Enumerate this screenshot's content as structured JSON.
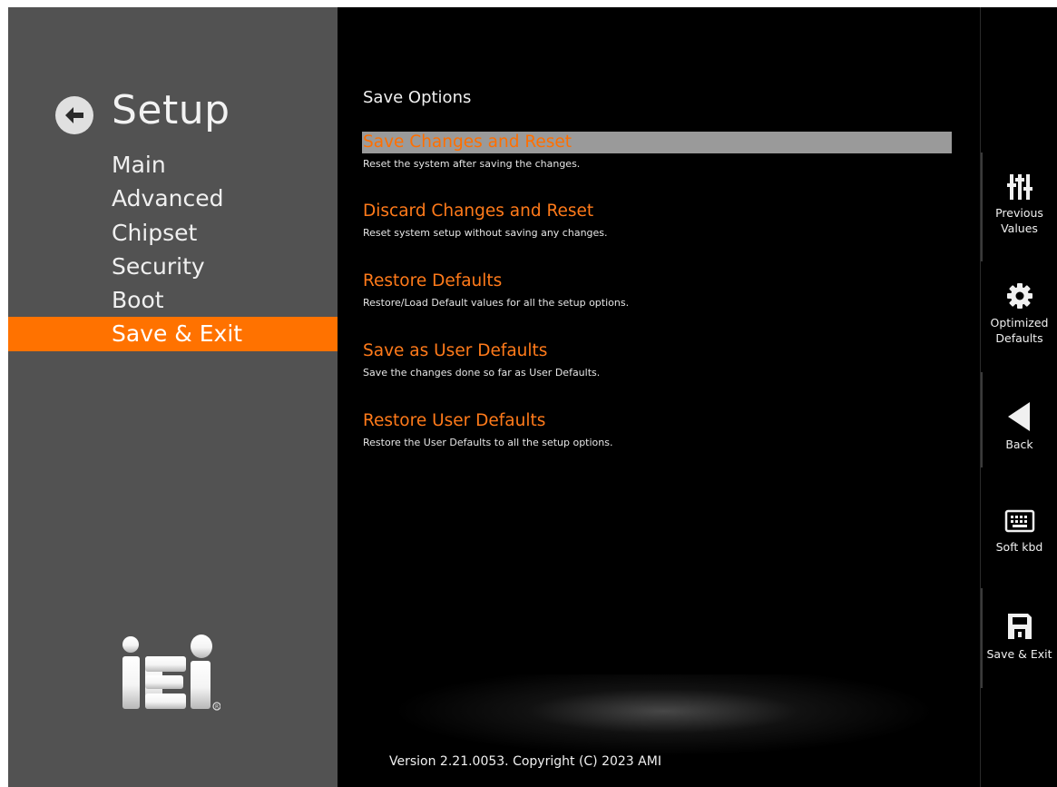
{
  "sidebar": {
    "title": "Setup",
    "items": [
      {
        "label": "Main"
      },
      {
        "label": "Advanced"
      },
      {
        "label": "Chipset"
      },
      {
        "label": "Security"
      },
      {
        "label": "Boot"
      },
      {
        "label": "Save & Exit",
        "active": true
      }
    ],
    "logo_text": "iEi"
  },
  "main": {
    "section_title": "Save Options",
    "options": [
      {
        "label": "Save Changes and Reset",
        "description": "Reset the system after saving the changes.",
        "selected": true
      },
      {
        "label": "Discard Changes and Reset",
        "description": "Reset system setup without saving any changes."
      },
      {
        "label": "Restore Defaults",
        "description": "Restore/Load Default values for all the setup options."
      },
      {
        "label": "Save as User Defaults",
        "description": "Save the changes done so far as User Defaults."
      },
      {
        "label": "Restore User Defaults",
        "description": "Restore the User Defaults to all the setup options."
      }
    ],
    "footer": "Version 2.21.0053. Copyright (C) 2023 AMI"
  },
  "toolbar": {
    "previous_values": {
      "line1": "Previous",
      "line2": "Values",
      "icon": "sliders-icon"
    },
    "optimized_defaults": {
      "line1": "Optimized",
      "line2": "Defaults",
      "icon": "gear-icon"
    },
    "back": {
      "label": "Back",
      "icon": "triangle-left-icon"
    },
    "soft_kbd": {
      "label": "Soft kbd",
      "icon": "keyboard-icon"
    },
    "save_exit": {
      "label": "Save & Exit",
      "icon": "floppy-disk-icon"
    }
  },
  "colors": {
    "accent": "#ff7200",
    "sidebar_bg": "#525252",
    "selected_bg": "#9a9a9a",
    "option_text": "#ff7a1a"
  }
}
